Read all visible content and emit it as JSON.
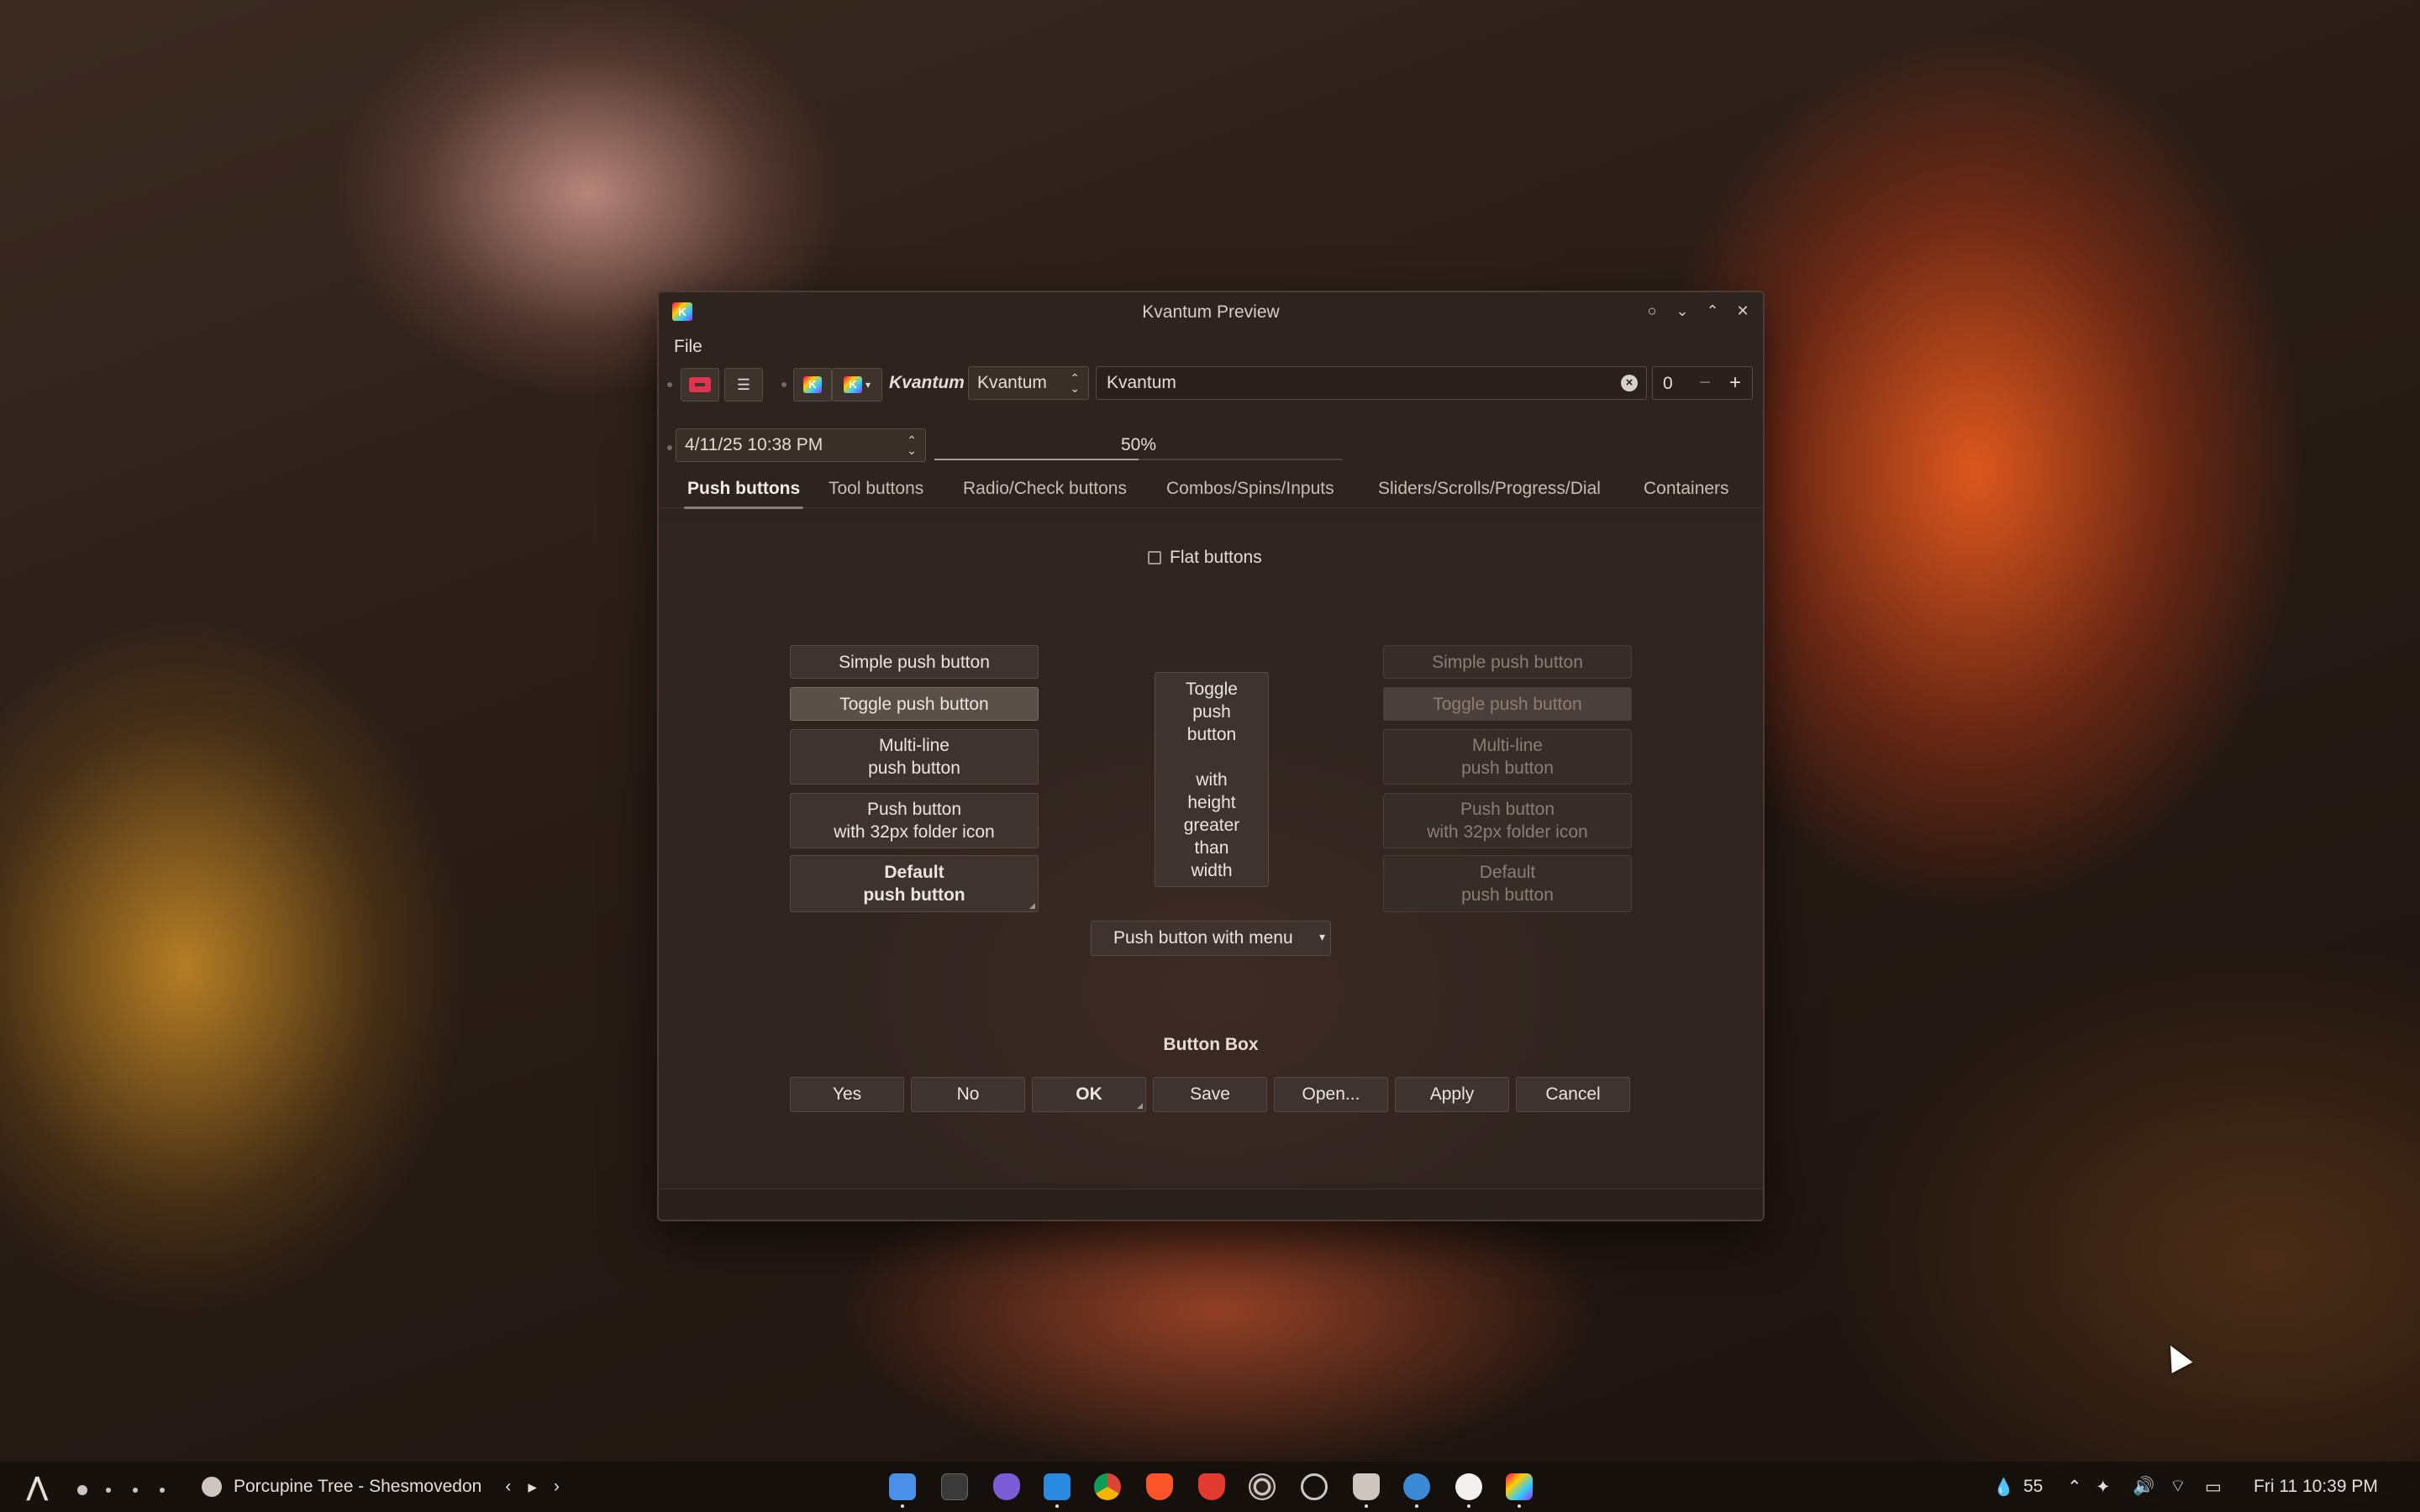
{
  "window": {
    "title": "Kvantum Preview",
    "logo_text": "K",
    "controls": [
      "○",
      "⌄",
      "⌃",
      "✕"
    ]
  },
  "menubar": {
    "file": "File"
  },
  "toolbar": {
    "label_italic": "Kvantum",
    "combo_value": "Kvantum",
    "line_edit_value": "Kvantum",
    "spin_value": "0",
    "spin_minus": "−",
    "spin_plus": "+",
    "datetime_value": "4/11/25 10:38 PM",
    "progress_text": "50%",
    "progress": 0.5
  },
  "tabs": [
    "Push buttons",
    "Tool buttons",
    "Radio/Check buttons",
    "Combos/Spins/Inputs",
    "Sliders/Scrolls/Progress/Dial",
    "Containers"
  ],
  "active_tab": "Push buttons",
  "flat_buttons_label": "Flat buttons",
  "enabled_buttons": {
    "simple": "Simple push button",
    "toggle": "Toggle push button",
    "multiline": "Multi-line\npush button",
    "folder": "Push button\nwith 32px folder icon",
    "default": "Default\npush button"
  },
  "disabled_buttons": {
    "simple": "Simple push button",
    "toggle": "Toggle push button",
    "multiline": "Multi-line\npush button",
    "folder": "Push button\nwith 32px folder icon",
    "default": "Default\npush button"
  },
  "tall_toggle": "Toggle\npush\nbutton\n\nwith\nheight\ngreater\nthan\nwidth",
  "menu_button": "Push button with menu",
  "button_box": {
    "title": "Button Box",
    "buttons": [
      "Yes",
      "No",
      "OK",
      "Save",
      "Open...",
      "Apply",
      "Cancel"
    ]
  },
  "taskbar": {
    "media_title": "Porcupine Tree - Shesmovedon",
    "media_prev": "‹",
    "media_play": "▸",
    "media_next": "›",
    "tray_temp": "55",
    "clock": "Fri 11  10:39 PM",
    "app_icons": [
      "files-icon",
      "terminal-icon",
      "obsidian-icon",
      "vscode-icon",
      "chrome-icon",
      "brave-icon",
      "brave-beta-icon",
      "circle-app-icon",
      "github-icon",
      "gamepad-icon",
      "steam-icon",
      "discord-icon",
      "kvantum-icon"
    ]
  },
  "colors": {
    "accent": "#8b7b74",
    "window_bg": "#2d231f",
    "kvantum_red": "#e0334f"
  }
}
